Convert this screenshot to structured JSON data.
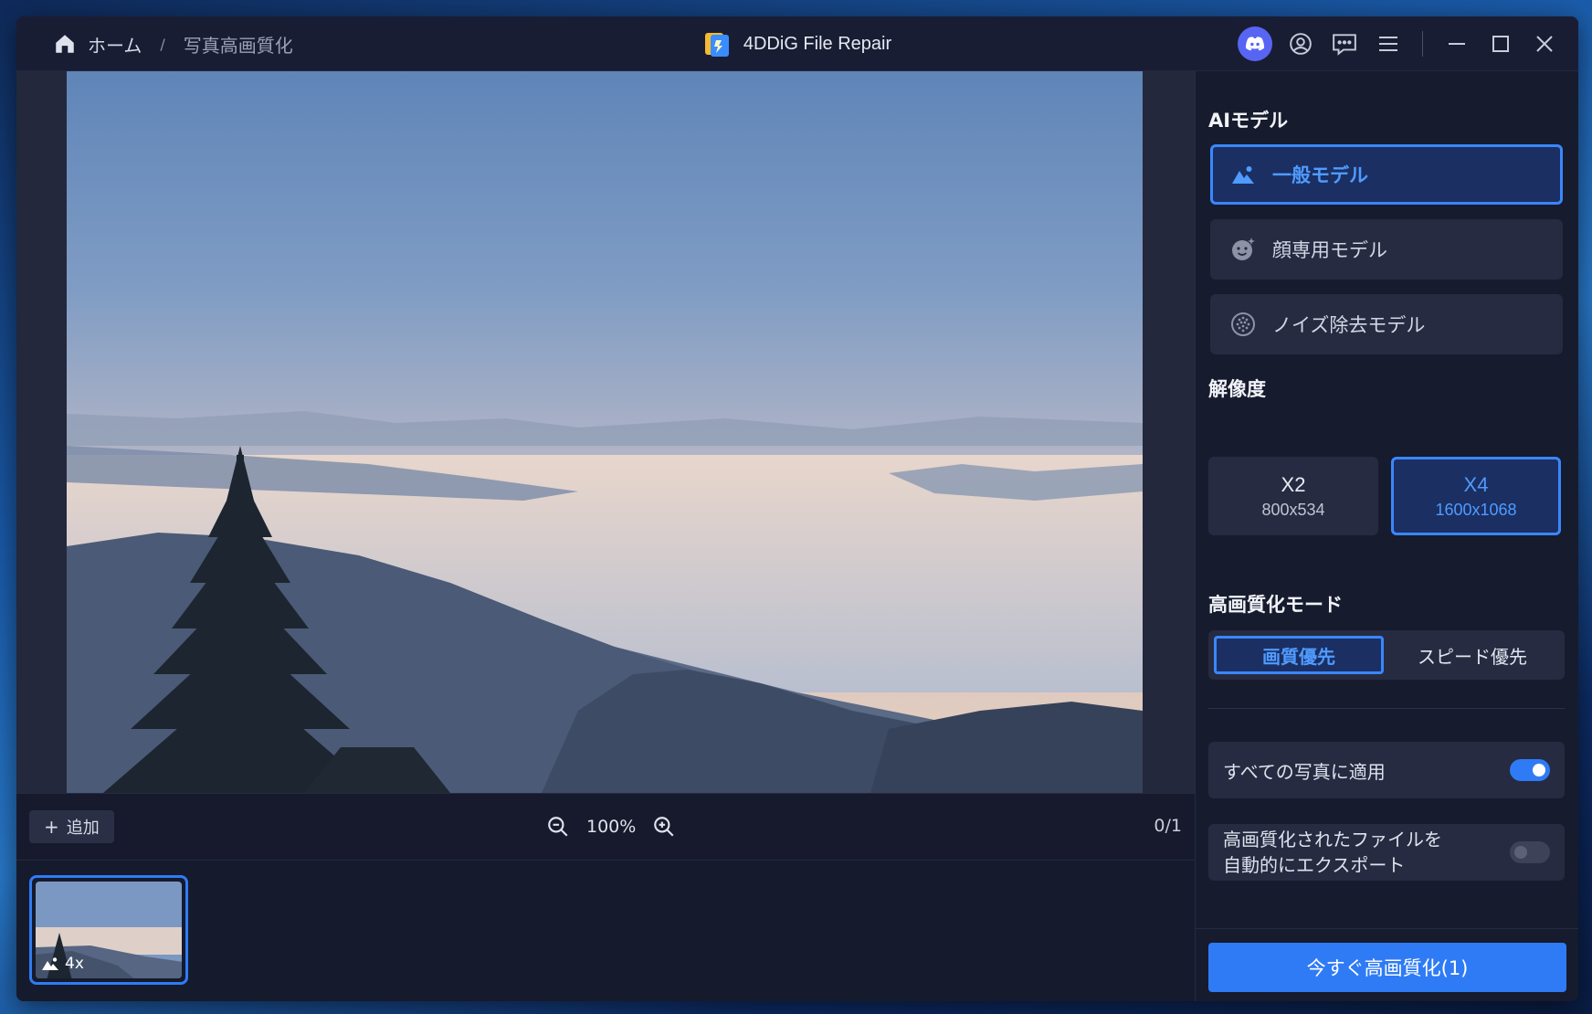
{
  "breadcrumb": {
    "home": "ホーム",
    "separator": "/",
    "current": "写真高画質化"
  },
  "app": {
    "title": "4DDiG File Repair"
  },
  "preview": {
    "add_label": "追加",
    "zoom_level": "100%",
    "page_count": "0/1",
    "thumb_scale": "4x"
  },
  "settings": {
    "ai_model_title": "AIモデル",
    "models": [
      {
        "label": "一般モデル",
        "icon": "landscape-icon",
        "selected": true
      },
      {
        "label": "顔専用モデル",
        "icon": "face-icon",
        "selected": false
      },
      {
        "label": "ノイズ除去モデル",
        "icon": "noise-icon",
        "selected": false
      }
    ],
    "resolution_title": "解像度",
    "resolutions": [
      {
        "scale": "X2",
        "size": "800x534",
        "selected": false
      },
      {
        "scale": "X4",
        "size": "1600x1068",
        "selected": true
      }
    ],
    "mode_title": "高画質化モード",
    "modes": [
      {
        "label": "画質優先",
        "selected": true
      },
      {
        "label": "スピード優先",
        "selected": false
      }
    ],
    "apply_all": {
      "label": "すべての写真に適用",
      "on": true
    },
    "auto_export": {
      "line1": "高画質化されたファイルを",
      "line2": "自動的にエクスポート",
      "on": false
    },
    "enhance_button": "今すぐ高画質化(1)"
  },
  "colors": {
    "accent": "#2f7bf5",
    "selected_bg": "#1b2f63",
    "panel": "#262b42",
    "window": "#171b30",
    "discord": "#5865f2"
  }
}
